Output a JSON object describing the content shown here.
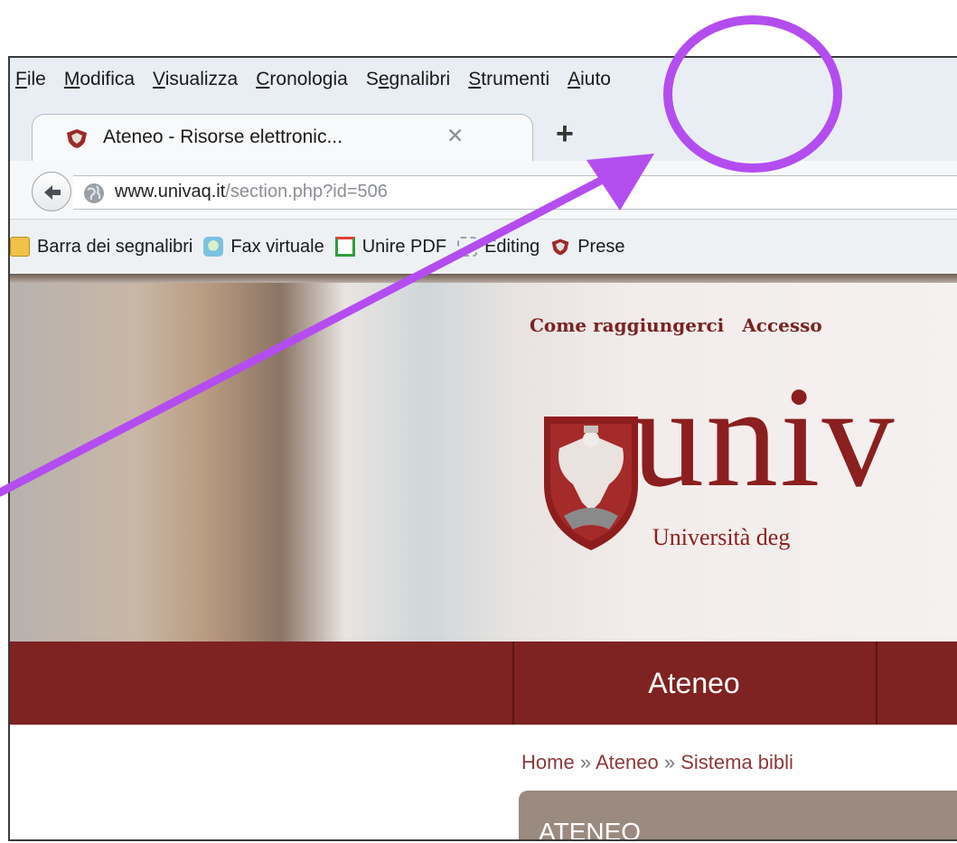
{
  "browser": {
    "menu": [
      {
        "label": "File",
        "underline": "F",
        "rest": "ile"
      },
      {
        "label": "Modifica",
        "underline": "M",
        "rest": "odifica"
      },
      {
        "label": "Visualizza",
        "underline": "V",
        "rest": "isualizza"
      },
      {
        "label": "Cronologia",
        "underline": "C",
        "rest": "ronologia"
      },
      {
        "label": "Segnalibri",
        "underline_prefix": "S",
        "underline": "e",
        "rest": "gnalibri"
      },
      {
        "label": "Strumenti",
        "underline": "S",
        "rest": "trumenti"
      },
      {
        "label": "Aiuto",
        "underline": "A",
        "rest": "iuto"
      }
    ],
    "tab": {
      "title": "Ateneo - Risorse elettronic...",
      "close": "✕"
    },
    "new_tab": "+",
    "url": {
      "host": "www.univaq.it",
      "path": "/section.php?id=506"
    },
    "bookmarks": [
      {
        "label": "Barra dei segnalibri",
        "icon": "folder-icon"
      },
      {
        "label": "Fax virtuale",
        "icon": "fax-icon"
      },
      {
        "label": "Unire PDF",
        "icon": "pdf-icon"
      },
      {
        "label": "Editing",
        "icon": "dashed-box-icon"
      },
      {
        "label": "Prese",
        "icon": "univaq-favicon"
      }
    ]
  },
  "site": {
    "top_links": [
      "Come raggiungerci",
      "Accesso"
    ],
    "brand": "univ",
    "tagline": "Università deg",
    "nav_item": "Ateneo",
    "breadcrumb": {
      "home": "Home",
      "sep1": "»",
      "b1": "Ateneo",
      "sep2": "»",
      "b2": "Sistema bibli"
    },
    "side_title": "ATENEO"
  },
  "colors": {
    "accent": "#7f2222",
    "highlight": "#b44df0"
  }
}
